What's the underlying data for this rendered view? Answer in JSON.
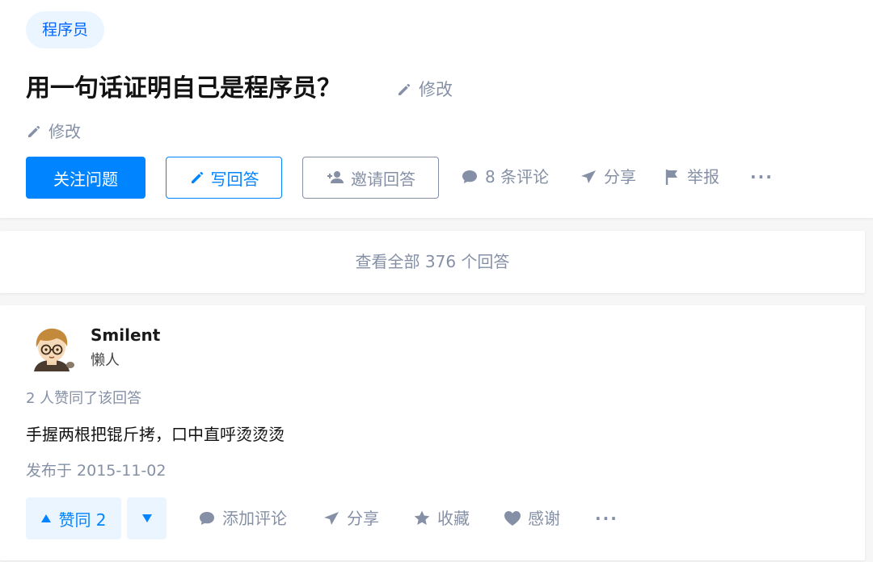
{
  "question": {
    "topic": "程序员",
    "title": "用一句话证明自己是程序员？",
    "title_edit_label": "修改",
    "desc_edit_label": "修改"
  },
  "actions": {
    "follow_label": "关注问题",
    "write_label": "写回答",
    "invite_label": "邀请回答",
    "comments_label": "8 条评论",
    "share_label": "分享",
    "report_label": "举报",
    "more_label": "···"
  },
  "view_all_label": "查看全部 376 个回答",
  "answer": {
    "author_name": "Smilent",
    "author_bio": "懒人",
    "vote_summary": "2 人赞同了该回答",
    "content": "手握两根把锟斤拷，口中直呼烫烫烫",
    "published": "发布于 2015-11-02",
    "upvote_label": "赞同 2",
    "comment_label": "添加评论",
    "share_label": "分享",
    "collect_label": "收藏",
    "thanks_label": "感谢",
    "more_label": "···"
  },
  "colors": {
    "accent": "#0084ff",
    "muted": "#8590a6",
    "tag_bg": "#ebf5ff"
  },
  "icons": [
    "pencil-icon",
    "add-user-icon",
    "comment-icon",
    "paper-plane-icon",
    "flag-icon",
    "more-icon",
    "triangle-up-icon",
    "triangle-down-icon",
    "star-icon",
    "heart-icon"
  ]
}
